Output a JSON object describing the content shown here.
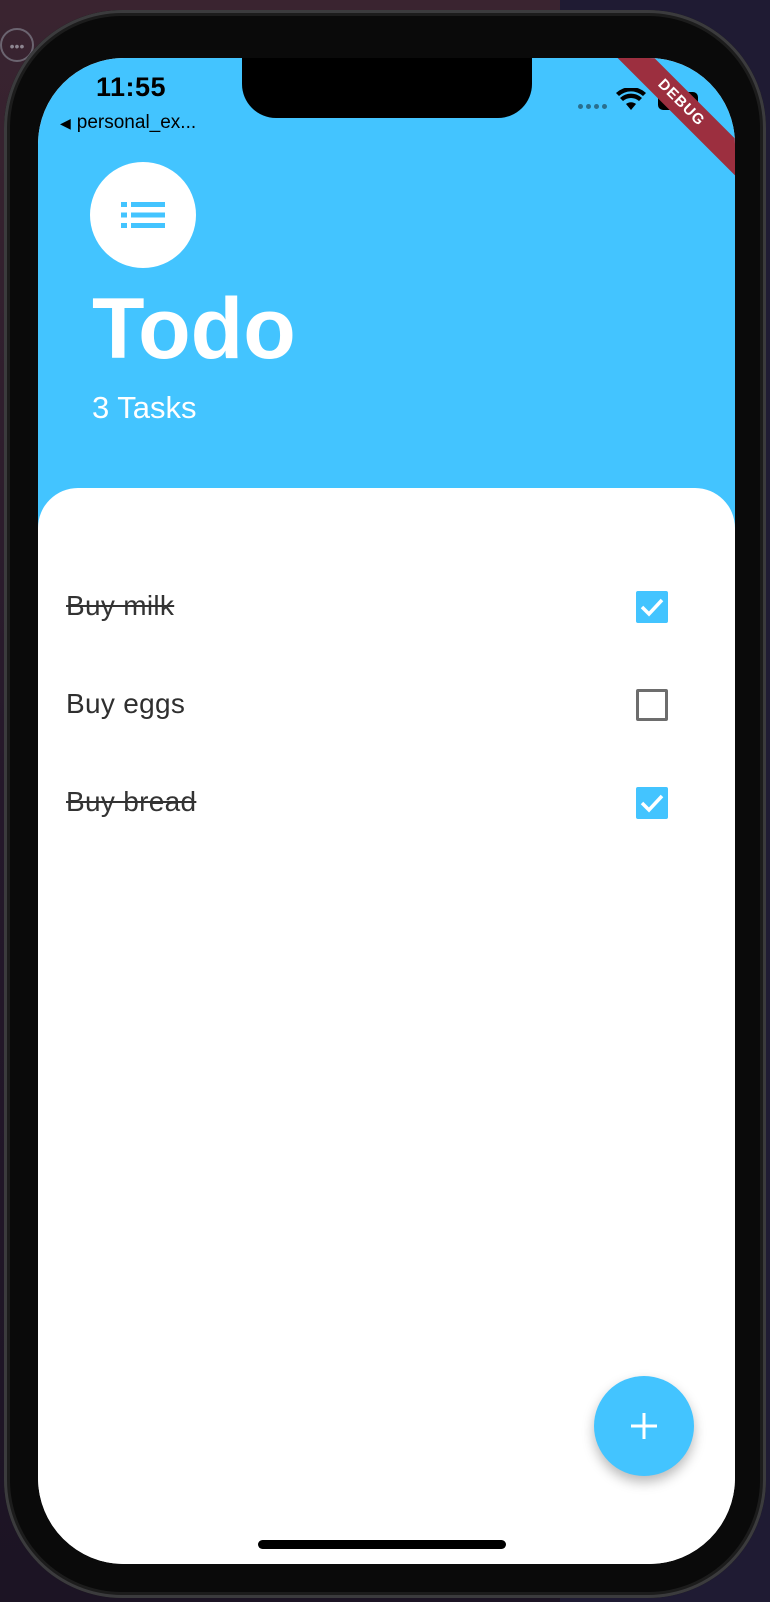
{
  "status_bar": {
    "time": "11:55",
    "back_app": "personal_ex..."
  },
  "debug_banner": "DEBUG",
  "header": {
    "icon": "list-icon",
    "title": "Todo",
    "subtitle": "3 Tasks"
  },
  "todos": [
    {
      "text": "Buy milk",
      "done": true
    },
    {
      "text": "Buy eggs",
      "done": false
    },
    {
      "text": "Buy bread",
      "done": true
    }
  ],
  "fab": {
    "icon": "plus-icon"
  },
  "colors": {
    "accent": "#43c4ff",
    "debug_ribbon": "#9c2f3f",
    "text": "#2f2f2f"
  }
}
